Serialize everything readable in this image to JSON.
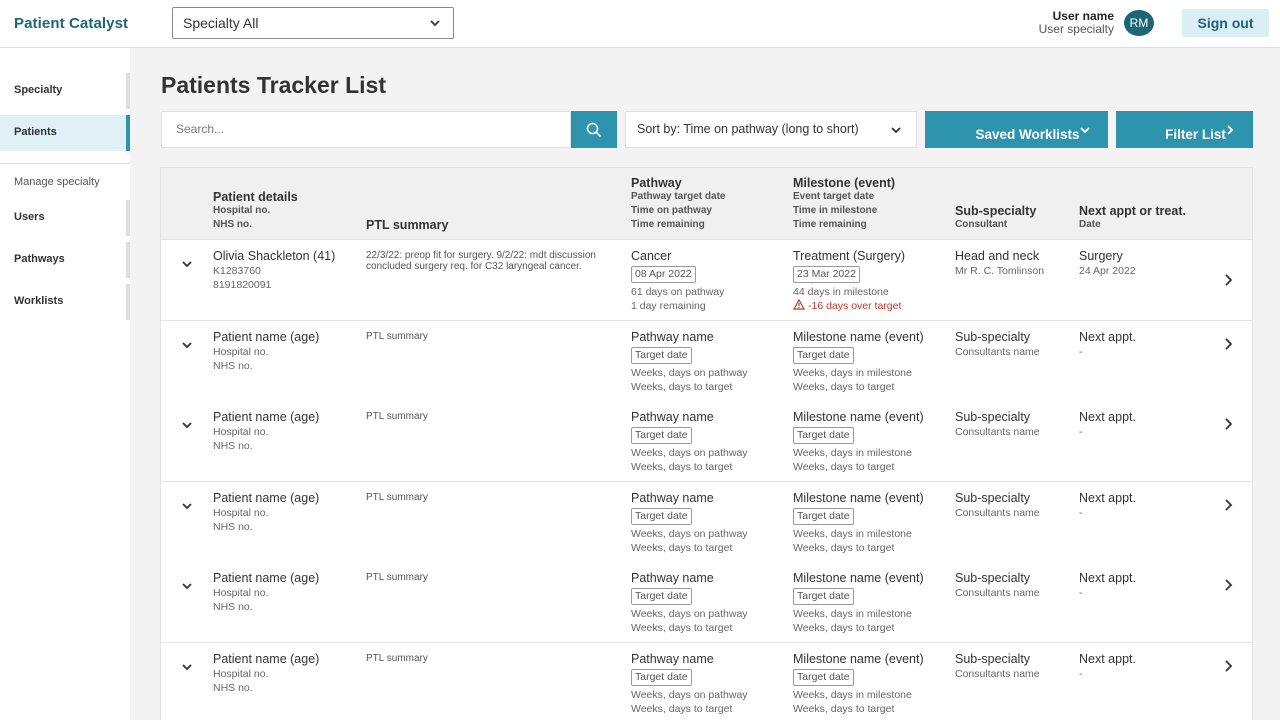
{
  "header": {
    "brand": "Patient Catalyst",
    "specialty_select": "Specialty All",
    "user_name": "User name",
    "user_specialty": "User specialty",
    "avatar_initials": "RM",
    "sign_out": "Sign out"
  },
  "sidebar": {
    "items": [
      {
        "label": "Specialty",
        "active": false
      },
      {
        "label": "Patients",
        "active": true
      }
    ],
    "manage_heading": "Manage specialty",
    "manage_items": [
      {
        "label": "Users"
      },
      {
        "label": "Pathways"
      },
      {
        "label": "Worklists"
      }
    ]
  },
  "main": {
    "title": "Patients Tracker List",
    "search_placeholder": "Search...",
    "sort_label": "Sort by: Time on pathway (long to short)",
    "saved_worklists": "Saved Worklists",
    "filter_list": "Filter List"
  },
  "table": {
    "headers": {
      "patient": {
        "title": "Patient details",
        "sub1": "Hospital no.",
        "sub2": "NHS no."
      },
      "ptl": {
        "title": "PTL summary"
      },
      "pathway": {
        "title": "Pathway",
        "sub1": "Pathway target date",
        "sub2": "Time on pathway",
        "sub3": "Time remaining"
      },
      "milestone": {
        "title": "Milestone (event)",
        "sub1": "Event target date",
        "sub2": "Time in milestone",
        "sub3": "Time remaining"
      },
      "subspecialty": {
        "title": "Sub-specialty",
        "sub1": "Consultant"
      },
      "next": {
        "title": "Next appt or treat.",
        "sub1": "Date"
      }
    },
    "rows": [
      {
        "name": "Olivia Shackleton (41)",
        "hospital_no": "K1283760",
        "nhs_no": "8191820091",
        "ptl_summary": "22/3/22: preop fit for surgery. 9/2/22: mdt discussion concluded surgery req. for C32 laryngeal cancer.",
        "pathway": "Cancer",
        "pathway_date": "08 Apr 2022",
        "pathway_time": "61 days on pathway",
        "pathway_remaining": "1 day remaining",
        "milestone": "Treatment (Surgery)",
        "milestone_date": "23 Mar 2022",
        "milestone_time": "44 days in milestone",
        "milestone_remaining": "-16 days over target",
        "subspecialty": "Head and neck",
        "consultant": "Mr R. C. Tomlinson",
        "next": "Surgery",
        "next_date": "24 Apr 2022"
      },
      {
        "name": "Patient name (age)",
        "hospital_no": "Hospital no.",
        "nhs_no": "NHS no.",
        "ptl_summary": "PTL summary",
        "pathway": "Pathway name",
        "pathway_date": "Target date",
        "pathway_time": "Weeks, days on pathway",
        "pathway_remaining": "Weeks, days to target",
        "milestone": "Milestone name (event)",
        "milestone_date": "Target date",
        "milestone_time": "Weeks, days in milestone",
        "milestone_remaining": "Weeks, days to target",
        "subspecialty": "Sub-specialty",
        "consultant": "Consultants name",
        "next": "Next appt.",
        "next_date": "-"
      },
      {
        "name": "Patient name (age)",
        "hospital_no": "Hospital no.",
        "nhs_no": "NHS no.",
        "ptl_summary": "PTL summary",
        "pathway": "Pathway name",
        "pathway_date": "Target date",
        "pathway_time": "Weeks, days on pathway",
        "pathway_remaining": "Weeks, days to target",
        "milestone": "Milestone name (event)",
        "milestone_date": "Target date",
        "milestone_time": "Weeks, days in milestone",
        "milestone_remaining": "Weeks, days to target",
        "subspecialty": "Sub-specialty",
        "consultant": "Consultants name",
        "next": "Next appt.",
        "next_date": "-"
      },
      {
        "name": "Patient name (age)",
        "hospital_no": "Hospital no.",
        "nhs_no": "NHS no.",
        "ptl_summary": "PTL summary",
        "pathway": "Pathway name",
        "pathway_date": "Target date",
        "pathway_time": "Weeks, days on pathway",
        "pathway_remaining": "Weeks, days to target",
        "milestone": "Milestone name (event)",
        "milestone_date": "Target date",
        "milestone_time": "Weeks, days in milestone",
        "milestone_remaining": "Weeks, days to target",
        "subspecialty": "Sub-specialty",
        "consultant": "Consultants name",
        "next": "Next appt.",
        "next_date": "-"
      },
      {
        "name": "Patient name (age)",
        "hospital_no": "Hospital no.",
        "nhs_no": "NHS no.",
        "ptl_summary": "PTL summary",
        "pathway": "Pathway name",
        "pathway_date": "Target date",
        "pathway_time": "Weeks, days on pathway",
        "pathway_remaining": "Weeks, days to target",
        "milestone": "Milestone name (event)",
        "milestone_date": "Target date",
        "milestone_time": "Weeks, days in milestone",
        "milestone_remaining": "Weeks, days to target",
        "subspecialty": "Sub-specialty",
        "consultant": "Consultants name",
        "next": "Next appt.",
        "next_date": "-"
      },
      {
        "name": "Patient name (age)",
        "hospital_no": "Hospital no.",
        "nhs_no": "NHS no.",
        "ptl_summary": "PTL summary",
        "pathway": "Pathway name",
        "pathway_date": "Target date",
        "pathway_time": "Weeks, days on pathway",
        "pathway_remaining": "Weeks, days to target",
        "milestone": "Milestone name (event)",
        "milestone_date": "Target date",
        "milestone_time": "Weeks, days in milestone",
        "milestone_remaining": "Weeks, days to target",
        "subspecialty": "Sub-specialty",
        "consultant": "Consultants name",
        "next": "Next appt.",
        "next_date": "-"
      }
    ]
  },
  "colors": {
    "brand": "#1e6577",
    "accent": "#2e93ad",
    "warning": "#c0392b"
  },
  "icons": [
    "chevron-down-icon",
    "search-icon",
    "chevron-right-icon",
    "warning-icon"
  ]
}
